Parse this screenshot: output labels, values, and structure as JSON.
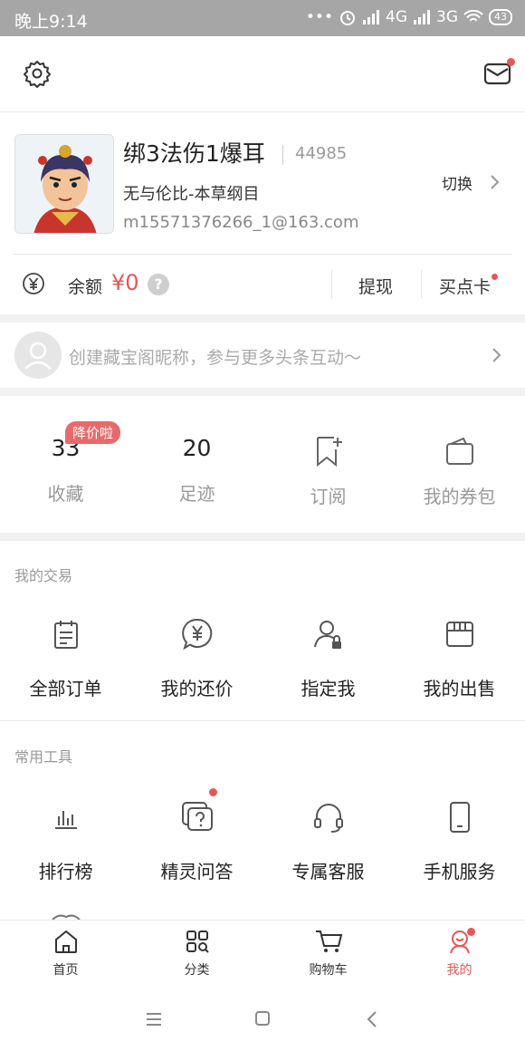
{
  "status_bar": {
    "time": "晚上9:14",
    "dots": "•••",
    "net1": "4G",
    "net2": "3G",
    "battery": "43"
  },
  "profile": {
    "nickname": "绑3法伤1爆耳",
    "id": "44985",
    "server": "无与伦比-本草纲目",
    "email": "m15571376266_1@163.com",
    "switch_label": "切换"
  },
  "balance": {
    "label": "余额",
    "value": "¥0",
    "help": "?",
    "withdraw": "提现",
    "buy_card": "买点卡"
  },
  "hint": {
    "text": "创建藏宝阁昵称，参与更多头条互动～"
  },
  "stats": [
    {
      "value": "33",
      "label": "收藏",
      "badge": "降价啦"
    },
    {
      "value": "20",
      "label": "足迹"
    },
    {
      "label": "订阅"
    },
    {
      "label": "我的券包"
    }
  ],
  "trade": {
    "title": "我的交易",
    "items": [
      {
        "label": "全部订单",
        "icon": "order-icon"
      },
      {
        "label": "我的还价",
        "icon": "yen-bubble-icon"
      },
      {
        "label": "指定我",
        "icon": "user-lock-icon"
      },
      {
        "label": "我的出售",
        "icon": "shop-icon"
      }
    ]
  },
  "tools": {
    "title": "常用工具",
    "items": [
      {
        "label": "排行榜",
        "icon": "bar-chart-icon"
      },
      {
        "label": "精灵问答",
        "icon": "question-bubble-icon"
      },
      {
        "label": "专属客服",
        "icon": "headset-icon"
      },
      {
        "label": "手机服务",
        "icon": "phone-icon"
      }
    ]
  },
  "tabbar": [
    {
      "label": "首页",
      "icon": "home-icon"
    },
    {
      "label": "分类",
      "icon": "category-icon"
    },
    {
      "label": "购物车",
      "icon": "cart-icon"
    },
    {
      "label": "我的",
      "icon": "profile-icon"
    }
  ],
  "colors": {
    "accent": "#e85656",
    "status_bar": "#a6a6a6",
    "muted": "#999999"
  }
}
